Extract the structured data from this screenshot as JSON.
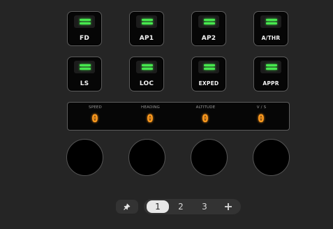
{
  "colors": {
    "background": "#252525",
    "panel": "#060606",
    "border": "#5c5c5c",
    "led_on": "#47e84e",
    "display_digits": "#ff9a1e",
    "label_text": "#f2f2f2",
    "caption_text": "#9a9a9a",
    "toolbar_bg": "#333333",
    "active_page_bg": "#e8e8e8"
  },
  "buttons": [
    {
      "id": "fd",
      "label": "FD",
      "led": "on"
    },
    {
      "id": "ap1",
      "label": "AP1",
      "led": "on"
    },
    {
      "id": "ap2",
      "label": "AP2",
      "led": "on"
    },
    {
      "id": "athr",
      "label": "A/THR",
      "led": "on"
    },
    {
      "id": "ls",
      "label": "LS",
      "led": "on"
    },
    {
      "id": "loc",
      "label": "LOC",
      "led": "on"
    },
    {
      "id": "exped",
      "label": "EXPED",
      "led": "on"
    },
    {
      "id": "appr",
      "label": "APPR",
      "led": "on"
    }
  ],
  "display": {
    "cells": [
      {
        "caption": "SPEED",
        "value": "0"
      },
      {
        "caption": "HEADING",
        "value": "0"
      },
      {
        "caption": "ALTITUDE",
        "value": "0"
      },
      {
        "caption": "V / S",
        "value": "0"
      }
    ]
  },
  "knobs": [
    {
      "id": "speed-knob"
    },
    {
      "id": "heading-knob"
    },
    {
      "id": "altitude-knob"
    },
    {
      "id": "vs-knob"
    }
  ],
  "toolbar": {
    "pin_icon": "pin-icon",
    "add_icon": "plus-icon",
    "pages": [
      "1",
      "2",
      "3"
    ],
    "active_page": "1"
  }
}
